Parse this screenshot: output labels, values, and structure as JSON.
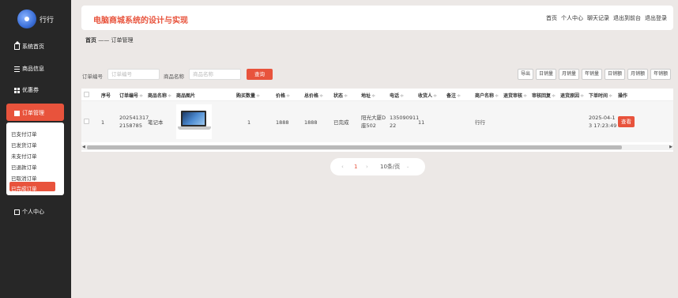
{
  "brand": {
    "name": "行行"
  },
  "sidebar": {
    "items": [
      {
        "label": "系统首页"
      },
      {
        "label": "商品信息"
      },
      {
        "label": "优惠券"
      },
      {
        "label": "订单管理"
      },
      {
        "label": "个人中心"
      }
    ],
    "submenu": [
      "已支付订单",
      "已发货订单",
      "未支付订单",
      "已退款订单",
      "已取消订单",
      "已完成订单"
    ]
  },
  "header": {
    "title": "电脑商城系统的设计与实现",
    "links": [
      "首页",
      "个人中心",
      "聊天记录",
      "退出到前台",
      "退出登录"
    ]
  },
  "breadcrumb": {
    "home": "首页",
    "separator": "——",
    "current": "订单管理"
  },
  "search": {
    "order_label": "订单编号",
    "order_placeholder": "订单编号",
    "product_label": "商品名称",
    "product_placeholder": "商品名称",
    "button": "查询"
  },
  "toolbar": [
    "导出",
    "日销量",
    "月销量",
    "年销量",
    "日销额",
    "月销额",
    "年销额"
  ],
  "table": {
    "headers": [
      "序号",
      "订单编号",
      "商品名称",
      "商品图片",
      "购买数量",
      "价格",
      "总价格",
      "状态",
      "地址",
      "电话",
      "收货人",
      "备注",
      "商户名称",
      "退货审核",
      "审核回复",
      "退货原因",
      "下单时间",
      "操作"
    ],
    "row": {
      "index": "1",
      "order_no_1": "202541317",
      "order_no_2": "2158785",
      "product": "笔记本",
      "qty": "1",
      "price": "1888",
      "total": "1888",
      "status": "已完成",
      "address_1": "阳光大厦D",
      "address_2": "座502",
      "phone_1": "135090911",
      "phone_2": "22",
      "receiver": "11",
      "merchant": "行行",
      "time_1": "2025-04-1",
      "time_2": "3 17:23:49",
      "action": "查看"
    }
  },
  "pagination": {
    "prev": "‹",
    "page": "1",
    "next": "›",
    "size": "10条/页"
  },
  "colors": {
    "accent": "#e8533c",
    "sidebar": "#272727"
  }
}
